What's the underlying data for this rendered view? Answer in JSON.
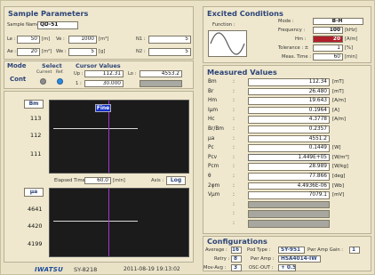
{
  "sample": {
    "title": "Sample Parameters",
    "name_label": "Sample Name :",
    "name_value": "QD-51",
    "le_label": "Le :",
    "le_value": "50",
    "le_unit": "[m]",
    "ve_label": "Ve :",
    "ve_value": "1000",
    "ve_unit": "[m³]",
    "n1_label": "N1 :",
    "n1_value": "5",
    "ae_label": "Ae :",
    "ae_value": "20",
    "ae_unit": "[m²]",
    "we_label": "We :",
    "we_value": "5",
    "we_unit": "[g]",
    "n2_label": "N2 :",
    "n2_value": "5"
  },
  "mode": {
    "title": "Mode",
    "value": "Cont"
  },
  "select": {
    "title": "Select",
    "current_label": "Current",
    "ref_label": "Ref."
  },
  "cursor": {
    "title": "Cursor Values",
    "up_label": "Up :",
    "up_value": "112.31",
    "lo_label": "Lo :",
    "lo_value": "4553.2",
    "i_label": "1 :",
    "i_value": "30.000"
  },
  "excited": {
    "title": "Excited Conditions",
    "function_label": "Function :",
    "mode_label": "Mode :",
    "mode_value": "B-H",
    "freq_label": "Frequency :",
    "freq_value": "100",
    "freq_unit": "[kHz]",
    "hm_label": "Hm :",
    "hm_value": "20",
    "hm_unit": "[A/m]",
    "tol_label": "Tolerance : ±",
    "tol_value": "1",
    "tol_unit": "[%]",
    "meas_label": "Meas. Time :",
    "meas_value": "60",
    "meas_unit": "[min]"
  },
  "measured": {
    "title": "Measured Values",
    "rows": [
      {
        "name": "Bm",
        "value": "112.34",
        "unit": "[mT]"
      },
      {
        "name": "Br",
        "value": "26.480",
        "unit": "[mT]"
      },
      {
        "name": "Hm",
        "value": "19.643",
        "unit": "[A/m]"
      },
      {
        "name": "Iμm",
        "value": "0.1964",
        "unit": "[A]"
      },
      {
        "name": "Hc",
        "value": "4.3778",
        "unit": "[A/m]"
      },
      {
        "name": "Br/Bm",
        "value": "0.2357",
        "unit": ""
      },
      {
        "name": "μa",
        "value": "4551.2",
        "unit": ""
      },
      {
        "name": "Pc",
        "value": "0.1449",
        "unit": "[W]"
      },
      {
        "name": "Pcv",
        "value": "1.449E+05",
        "unit": "[W/m³]"
      },
      {
        "name": "Pcm",
        "value": "28.989",
        "unit": "[W/kg]"
      },
      {
        "name": "θ",
        "value": "77.866",
        "unit": "[deg]"
      },
      {
        "name": "2φm",
        "value": "4.4936E-06",
        "unit": "[Wb]"
      },
      {
        "name": "Vμm",
        "value": "7079.1",
        "unit": "[mV]"
      },
      {
        "name": "",
        "value": "",
        "unit": ""
      },
      {
        "name": "",
        "value": "",
        "unit": ""
      },
      {
        "name": "",
        "value": "",
        "unit": ""
      }
    ]
  },
  "graph_top": {
    "tab": "Bm",
    "mode_label": "Fine",
    "ticks": [
      "113",
      "112",
      "111"
    ]
  },
  "elapsed": {
    "label": "Elapsed Time :",
    "value": "60.0",
    "unit": "[min]",
    "axis_label": "Axis :",
    "axis_value": "Log"
  },
  "graph_bottom": {
    "tab": "μa",
    "ticks": [
      "4641",
      "4420",
      "4199"
    ]
  },
  "config": {
    "title": "Configurations",
    "average_label": "Average :",
    "average_value": "16",
    "retry_label": "Retry :",
    "retry_value": "8",
    "movavg_label": "Mov-Avg :",
    "movavg_value": "3",
    "pod_label": "Pod Type :",
    "pod_value": "SY-951",
    "amp_label": "Pwr Amp :",
    "amp_value": "HSA4014-IW",
    "osc_label": "OSC-OUT :",
    "osc_value": "+ 0.5",
    "gain_label": "Pwr Amp Gain :",
    "gain_value": "1"
  },
  "footer": {
    "brand": "IWATSU",
    "model": "SY-8218",
    "timestamp": "2011-08-19 19:13:02"
  },
  "colors": {
    "accent": "#2c4479",
    "highlight_red": "#b0202a",
    "current_dot": "#8e8e8e",
    "ref_dot": "#2c8be0",
    "cursor_line": "#a335d6"
  }
}
